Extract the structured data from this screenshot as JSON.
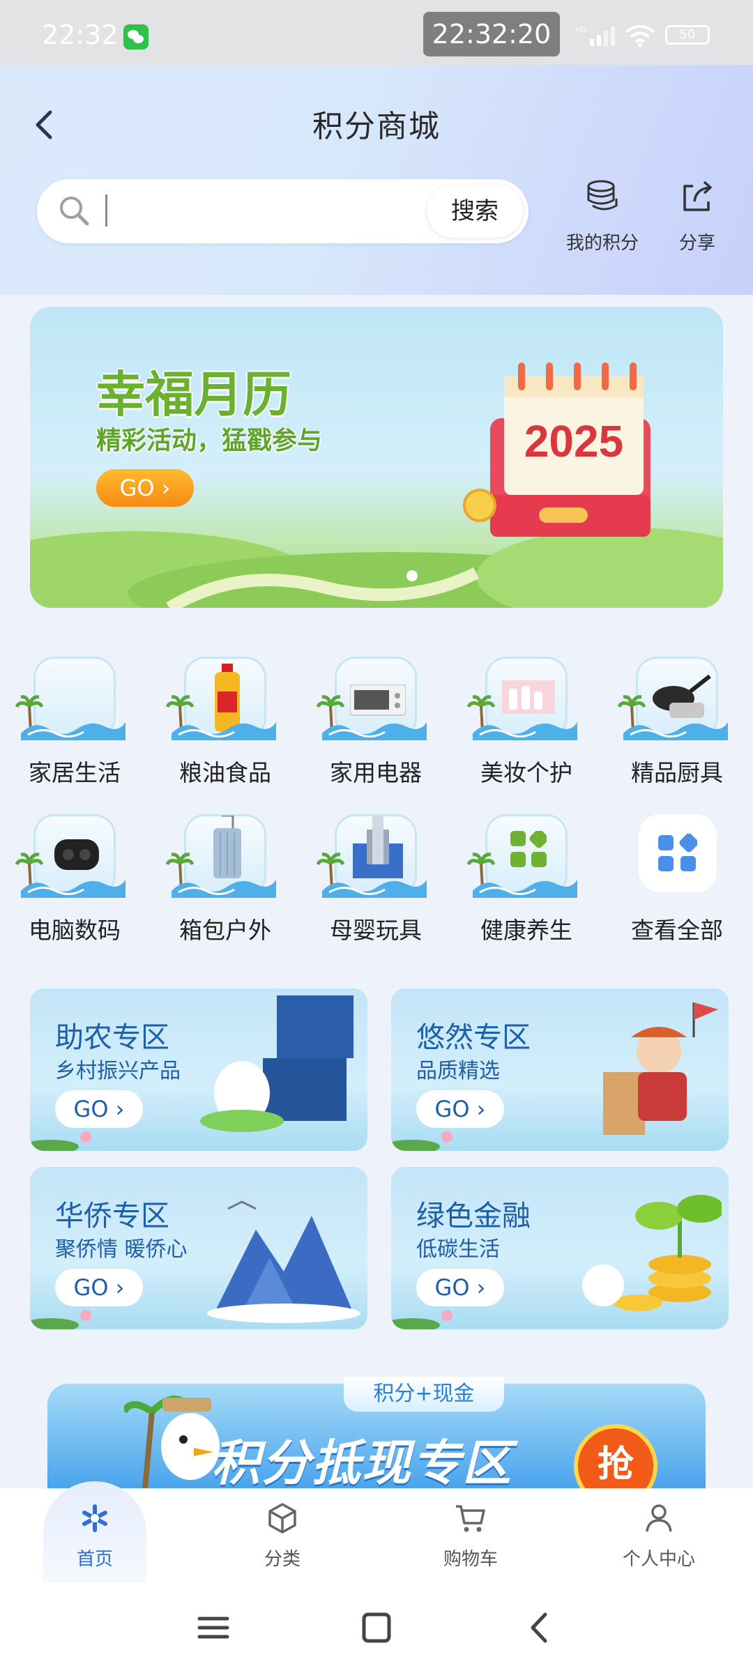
{
  "status_bar": {
    "time": "22:32",
    "clock_overlay": "22:32:20",
    "battery": "50"
  },
  "header": {
    "title": "积分商城",
    "search": {
      "placeholder": "",
      "button_label": "搜索"
    },
    "actions": [
      {
        "label": "我的积分",
        "icon": "coins-icon"
      },
      {
        "label": "分享",
        "icon": "share-icon"
      }
    ]
  },
  "banner": {
    "title": "幸福月历",
    "subtitle": "精彩活动，猛戳参与",
    "go_label": "GO ›",
    "calendar_year": "2025",
    "page_index": 1,
    "page_count": 1
  },
  "categories": [
    {
      "label": "家居生活",
      "icon": "home-goods-icon"
    },
    {
      "label": "粮油食品",
      "icon": "cooking-oil-icon"
    },
    {
      "label": "家用电器",
      "icon": "oven-icon"
    },
    {
      "label": "美妆个护",
      "icon": "cosmetics-icon"
    },
    {
      "label": "精品厨具",
      "icon": "cookware-icon"
    },
    {
      "label": "电脑数码",
      "icon": "earbuds-icon"
    },
    {
      "label": "箱包户外",
      "icon": "suitcase-icon"
    },
    {
      "label": "母婴玩具",
      "icon": "toy-rocket-icon"
    },
    {
      "label": "健康养生",
      "icon": "health-grid-icon"
    },
    {
      "label": "查看全部",
      "icon": "all-categories-icon"
    }
  ],
  "zones": [
    {
      "title": "助农专区",
      "subtitle": "乡村振兴产品",
      "go_label": "GO ›"
    },
    {
      "title": "悠然专区",
      "subtitle": "品质精选",
      "go_label": "GO ›"
    },
    {
      "title": "华侨专区",
      "subtitle": "聚侨情 暖侨心",
      "go_label": "GO ›"
    },
    {
      "title": "绿色金融",
      "subtitle": "低碳生活",
      "go_label": "GO ›"
    }
  ],
  "promo": {
    "tag": "积分+现金",
    "title": "积分抵现专区",
    "grab_label": "抢"
  },
  "tab_bar": [
    {
      "label": "首页",
      "icon": "home-icon",
      "active": true
    },
    {
      "label": "分类",
      "icon": "category-icon",
      "active": false
    },
    {
      "label": "购物车",
      "icon": "cart-icon",
      "active": false
    },
    {
      "label": "个人中心",
      "icon": "profile-icon",
      "active": false
    }
  ],
  "colors": {
    "accent": "#2d6fd6",
    "zone_text": "#1d5fa8",
    "banner_green": "#6ab12f",
    "go_orange": "#f58a12"
  }
}
